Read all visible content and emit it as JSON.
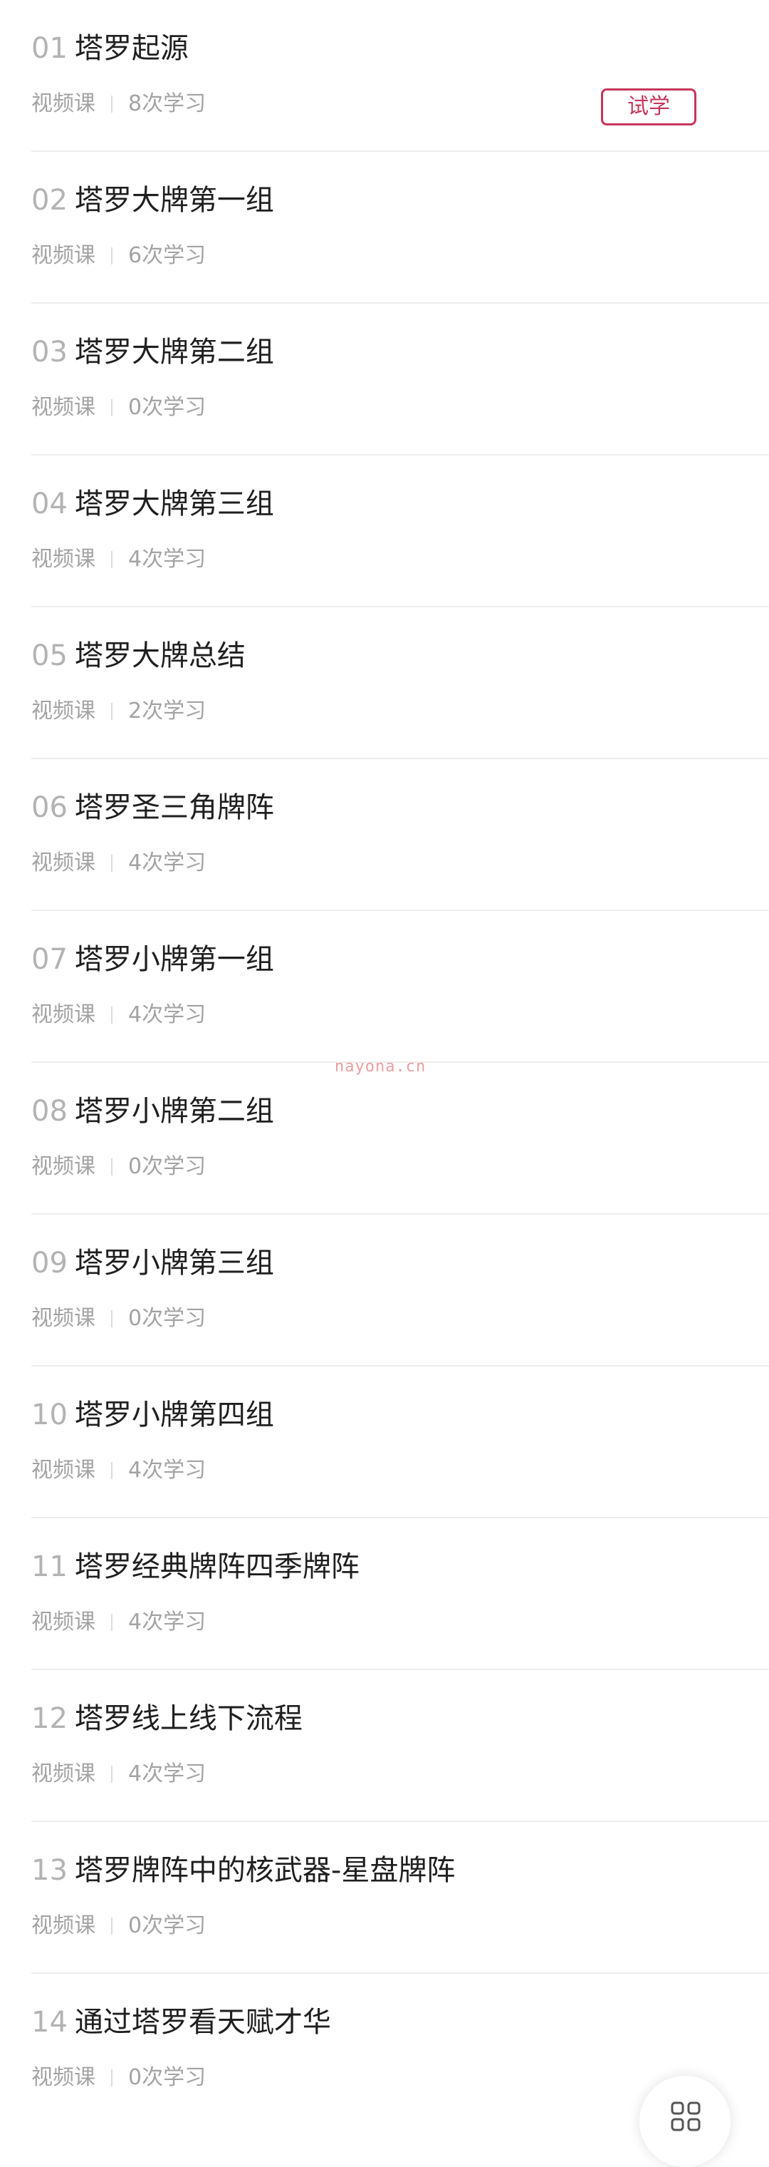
{
  "lessons": [
    {
      "num": "01",
      "title": "塔罗起源",
      "type": "视频课",
      "views": "8次学习",
      "trial": "试学"
    },
    {
      "num": "02",
      "title": "塔罗大牌第一组",
      "type": "视频课",
      "views": "6次学习"
    },
    {
      "num": "03",
      "title": "塔罗大牌第二组",
      "type": "视频课",
      "views": "0次学习"
    },
    {
      "num": "04",
      "title": "塔罗大牌第三组",
      "type": "视频课",
      "views": "4次学习"
    },
    {
      "num": "05",
      "title": "塔罗大牌总结",
      "type": "视频课",
      "views": "2次学习"
    },
    {
      "num": "06",
      "title": "塔罗圣三角牌阵",
      "type": "视频课",
      "views": "4次学习"
    },
    {
      "num": "07",
      "title": "塔罗小牌第一组",
      "type": "视频课",
      "views": "4次学习"
    },
    {
      "num": "08",
      "title": "塔罗小牌第二组",
      "type": "视频课",
      "views": "0次学习"
    },
    {
      "num": "09",
      "title": "塔罗小牌第三组",
      "type": "视频课",
      "views": "0次学习"
    },
    {
      "num": "10",
      "title": "塔罗小牌第四组",
      "type": "视频课",
      "views": "4次学习"
    },
    {
      "num": "11",
      "title": "塔罗经典牌阵四季牌阵",
      "type": "视频课",
      "views": "4次学习"
    },
    {
      "num": "12",
      "title": "塔罗线上线下流程",
      "type": "视频课",
      "views": "4次学习"
    },
    {
      "num": "13",
      "title": "塔罗牌阵中的核武器-星盘牌阵",
      "type": "视频课",
      "views": "0次学习"
    },
    {
      "num": "14",
      "title": "通过塔罗看天赋才华",
      "type": "视频课",
      "views": "0次学习"
    }
  ],
  "watermark": "nayona.cn",
  "float_button": {
    "icon": "grid-icon"
  },
  "colors": {
    "accent": "#c6365b",
    "title": "#1f1f1f",
    "muted": "#a3a3a3",
    "number": "#b3b3b3",
    "divider": "#ededed"
  }
}
